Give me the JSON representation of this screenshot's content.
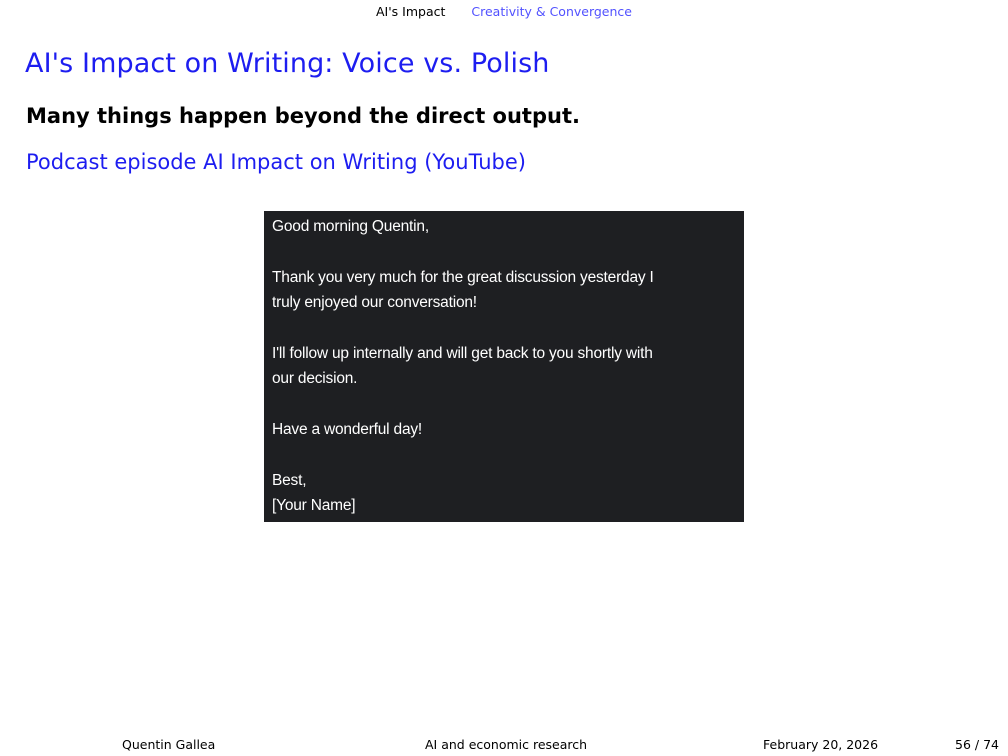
{
  "nav": {
    "section": "AI's Impact",
    "subsection": "Creativity & Convergence"
  },
  "slide": {
    "title": "AI's Impact on Writing: Voice vs. Polish",
    "subtitle": "Many things happen beyond the direct output.",
    "link_text": "Podcast episode AI Impact on Writing (YouTube)"
  },
  "email": {
    "greeting": "Good morning Quentin,",
    "para1_line1": "Thank you very much for the great discussion yesterday I",
    "para1_line2": "truly enjoyed our conversation!",
    "para2_line1": "I'll follow up internally and will get back to you shortly with",
    "para2_line2": "our decision.",
    "closing_wish": "Have a wonderful day!",
    "signoff": "Best,",
    "signature": "[Your Name]"
  },
  "footer": {
    "author": "Quentin Gallea",
    "talk_title": "AI and economic research",
    "date": "February 20, 2026",
    "page": "56 / 74"
  }
}
